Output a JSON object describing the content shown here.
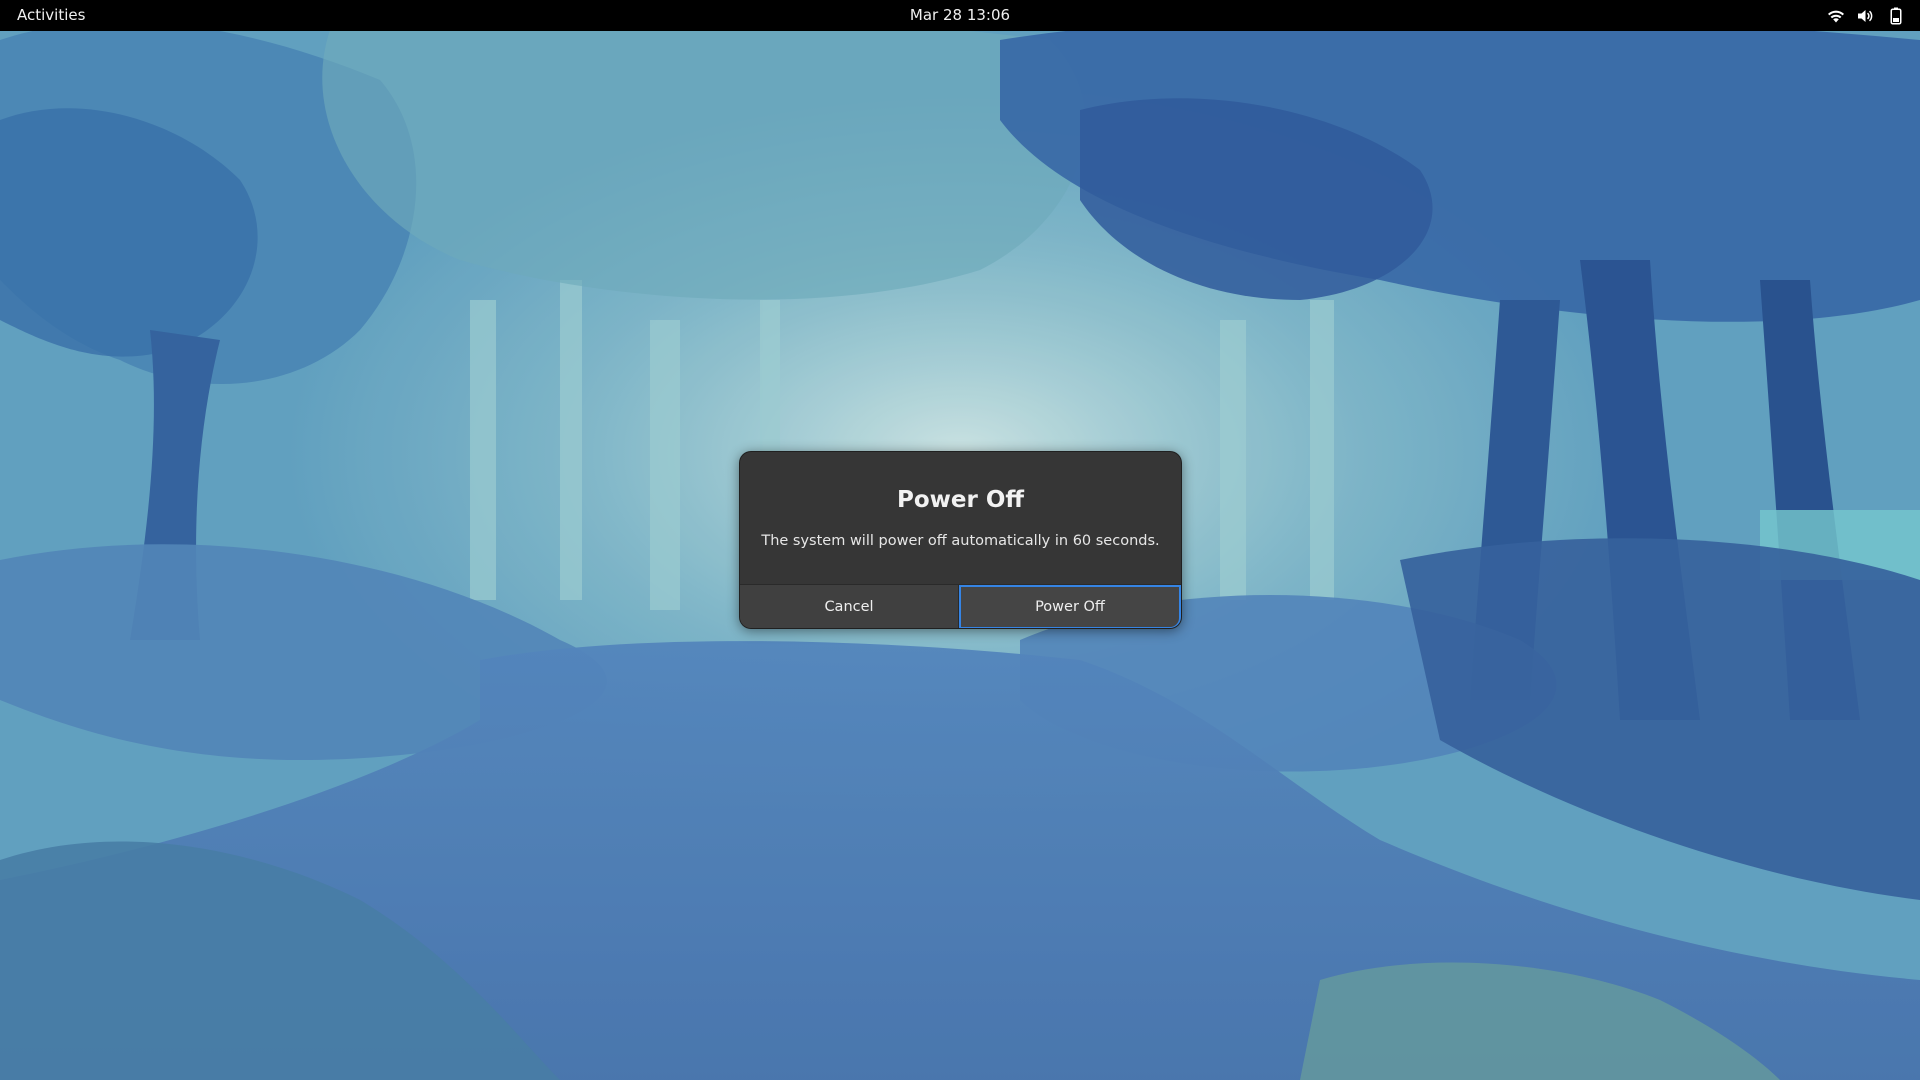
{
  "topbar": {
    "activities_label": "Activities",
    "clock": "Mar 28  13:06",
    "tray_icons": [
      "wifi-icon",
      "volume-icon",
      "battery-icon"
    ]
  },
  "dialog": {
    "title": "Power Off",
    "message": "The system will power off automatically in 60 seconds.",
    "cancel_label": "Cancel",
    "confirm_label": "Power Off",
    "focus_color": "#3584e4"
  },
  "colors": {
    "topbar_bg": "#000000",
    "dialog_bg": "#363636"
  }
}
